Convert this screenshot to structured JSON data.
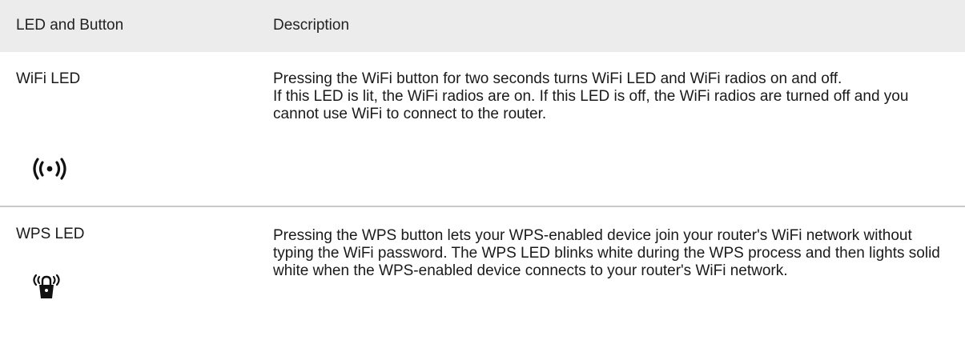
{
  "header": {
    "col1": "LED and Button",
    "col2": "Description"
  },
  "rows": [
    {
      "name": "WiFi LED",
      "icon": "wifi-radio-icon",
      "description": [
        "Pressing the WiFi button for two seconds turns WiFi LED and WiFi radios on and off.",
        "If this LED is lit, the WiFi radios are on. If this LED is off, the WiFi radios are turned off and you cannot use WiFi to connect to the router."
      ]
    },
    {
      "name": "WPS LED",
      "icon": "wps-lock-icon",
      "description": [
        "Pressing the WPS button lets your WPS-enabled device join your router's WiFi network without typing the WiFi password. The WPS LED blinks white during the WPS process and then lights solid white when the WPS-enabled device connects to your router's WiFi network."
      ]
    }
  ]
}
